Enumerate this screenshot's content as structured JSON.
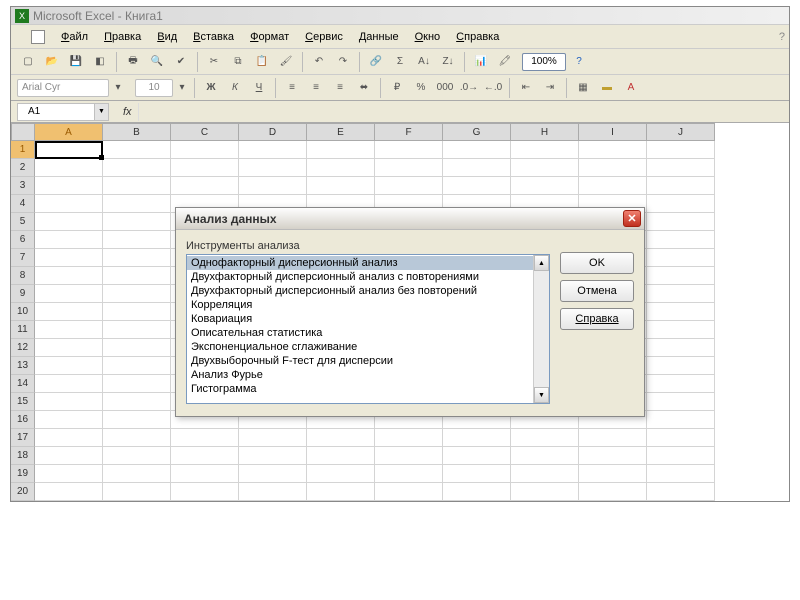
{
  "title": "Microsoft Excel - Книга1",
  "menu": [
    "Файл",
    "Правка",
    "Вид",
    "Вставка",
    "Формат",
    "Сервис",
    "Данные",
    "Окно",
    "Справка"
  ],
  "zoom": "100%",
  "font": {
    "name": "Arial Cyr",
    "size": "10"
  },
  "formula_btns": [
    "Ж",
    "К",
    "Ч"
  ],
  "namebox": "A1",
  "fx": "fx",
  "columns": [
    "A",
    "B",
    "C",
    "D",
    "E",
    "F",
    "G",
    "H",
    "I",
    "J"
  ],
  "row_count": 20,
  "dialog": {
    "title": "Анализ данных",
    "label": "Инструменты анализа",
    "items": [
      "Однофакторный дисперсионный анализ",
      "Двухфакторный дисперсионный анализ с повторениями",
      "Двухфакторный дисперсионный анализ без повторений",
      "Корреляция",
      "Ковариация",
      "Описательная статистика",
      "Экспоненциальное сглаживание",
      "Двухвыборочный F-тест для дисперсии",
      "Анализ Фурье",
      "Гистограмма"
    ],
    "selected": 0,
    "buttons": {
      "ok": "OK",
      "cancel": "Отмена",
      "help": "Справка"
    }
  }
}
